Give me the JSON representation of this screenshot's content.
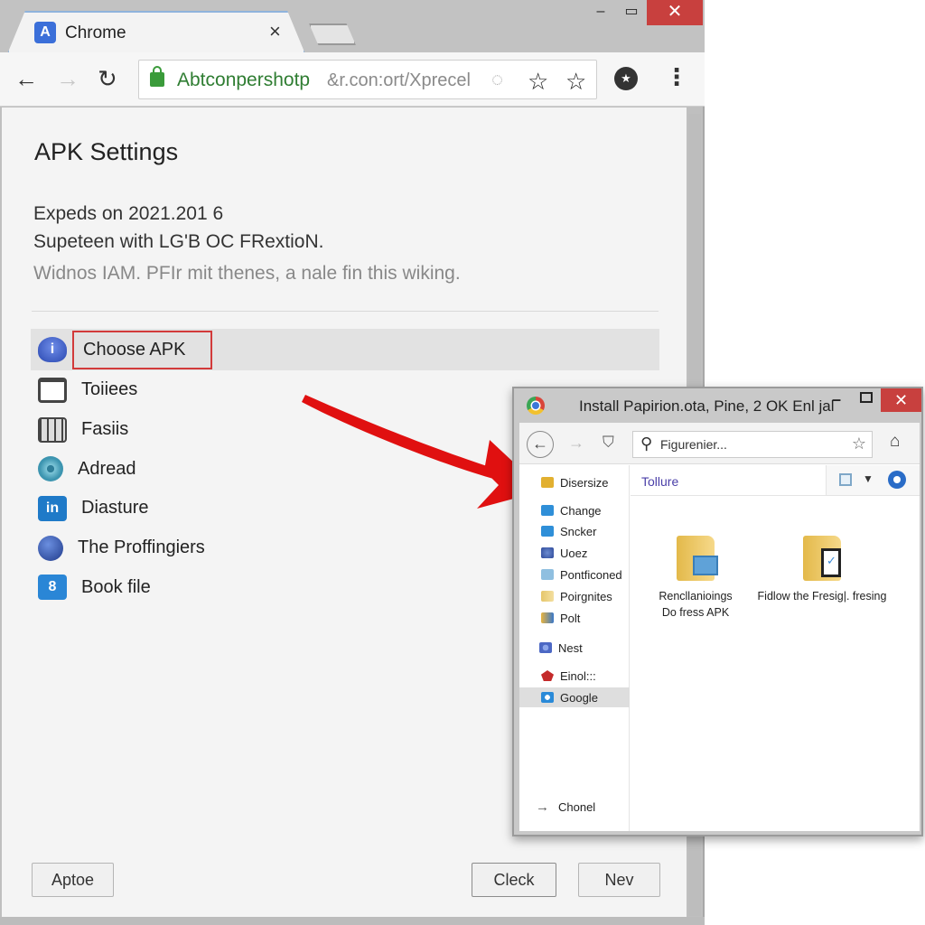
{
  "browser": {
    "tab": {
      "title": "Chrome",
      "favicon_letter": "A",
      "close_glyph": "×"
    },
    "window_controls": {
      "minimize": "–",
      "maximize": "▭",
      "close": "✕"
    },
    "toolbar": {
      "back_glyph": "←",
      "forward_glyph": "→",
      "reload_glyph": "↻",
      "url_host": "Abtconpershotp",
      "url_path": "&r.con:ort/Xprecel",
      "loader_glyph": "◌",
      "star_glyph": "☆",
      "extension_glyph": "★",
      "menu_glyph": "⋮"
    }
  },
  "page": {
    "title": "APK Settings",
    "description": [
      "Expeds on 2021.201 6",
      "Supeteen with LG'B OC FRextioN.",
      "Widnos IAM. PFIr mit thenes, a nale fin this wiking."
    ],
    "list_items": [
      {
        "label": "Choose APK",
        "icon": "info-icon",
        "selected": true,
        "glyph": "i"
      },
      {
        "label": "Toiiees",
        "icon": "calendar-icon",
        "selected": false,
        "glyph": ""
      },
      {
        "label": "Fasiis",
        "icon": "grid-icon",
        "selected": false,
        "glyph": ""
      },
      {
        "label": "Adreаd",
        "icon": "aperture-icon",
        "selected": false,
        "glyph": ""
      },
      {
        "label": "Diasture",
        "icon": "linkedin-icon",
        "selected": false,
        "glyph": "in"
      },
      {
        "label": "The Proffingiers",
        "icon": "globe-icon",
        "selected": false,
        "glyph": ""
      },
      {
        "label": "Book file",
        "icon": "eight-icon",
        "selected": false,
        "glyph": "8"
      }
    ],
    "buttons": {
      "left": "Aptoe",
      "check": "Cleck",
      "next": "Nev"
    }
  },
  "annotation": {
    "arrow_color": "#e01010",
    "highlight_color": "#d23a3a"
  },
  "dialog": {
    "title": "Install Papirion.ota, Pine, 2 OK Enl jal",
    "controls": {
      "minimize": "–",
      "close": "✕"
    },
    "toolbar": {
      "back_glyph": "←",
      "forward_glyph": "→",
      "shield_glyph": "⛉",
      "search_glyph": "⚲",
      "search_text": "Figurenier...",
      "star_glyph": "☆",
      "home_glyph": "⌂"
    },
    "location": "Tollure",
    "view_caret": "▼",
    "nav_items": [
      {
        "label": "Disersize",
        "icon": "warning-bell-icon"
      },
      {
        "label": "Change",
        "icon": "folder-icon"
      },
      {
        "label": "Sncker",
        "icon": "folder-icon"
      },
      {
        "label": "Uoez",
        "icon": "users-icon"
      },
      {
        "label": "Pontficoned",
        "icon": "folder-icon"
      },
      {
        "label": "Poirgnites",
        "icon": "folder-stack-icon"
      },
      {
        "label": "Polt",
        "icon": "book-icon"
      },
      {
        "label": "Nest",
        "icon": "nest-icon"
      },
      {
        "label": "Einol:::",
        "icon": "einol-icon"
      },
      {
        "label": "Google",
        "icon": "google-icon",
        "selected": true
      }
    ],
    "footer_item": {
      "label": "Chonel",
      "glyph": "→"
    },
    "files": [
      {
        "name_line1": "Rencllanioings",
        "name_line2": "Do fress APK"
      },
      {
        "name_line1": "Fidlow the Fresig|. fresing",
        "name_line2": ""
      }
    ]
  }
}
